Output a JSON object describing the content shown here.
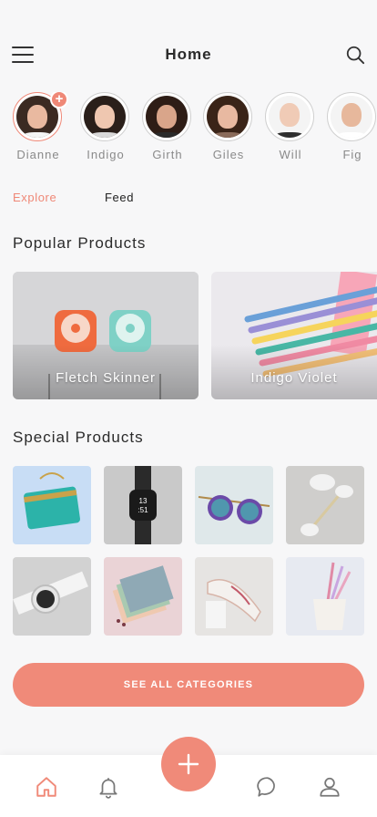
{
  "header": {
    "title": "Home"
  },
  "stories": [
    {
      "name": "Dianne",
      "active": true,
      "skin": "#e9b9a0",
      "hair": "#3b2a22",
      "body": "#ffffff"
    },
    {
      "name": "Indigo",
      "active": false,
      "skin": "#efc7b0",
      "hair": "#2a1f1a",
      "body": "#d9d9d9"
    },
    {
      "name": "Girth",
      "active": false,
      "skin": "#d9a58a",
      "hair": "#2e1d16",
      "body": "#2a2a2a"
    },
    {
      "name": "Giles",
      "active": false,
      "skin": "#e8b9a1",
      "hair": "#3a2418",
      "body": "#8a6b5a"
    },
    {
      "name": "Will",
      "active": false,
      "skin": "#f0cbb6",
      "hair": "#4a3324",
      "body": "#2e2e2e"
    },
    {
      "name": "Fig",
      "active": false,
      "skin": "#e7b89c",
      "hair": "#7a5a3e",
      "body": "#ffffff"
    }
  ],
  "tabs": {
    "explore": "Explore",
    "feed": "Feed"
  },
  "sections": {
    "popular": "Popular Products",
    "special": "Special Products"
  },
  "popular_products": [
    {
      "label": "Fletch Skinner"
    },
    {
      "label": "Indigo Violet"
    }
  ],
  "special_products": [
    {
      "name": "clutch-bag"
    },
    {
      "name": "smart-watch"
    },
    {
      "name": "sunglasses"
    },
    {
      "name": "face-roller"
    },
    {
      "name": "white-watch"
    },
    {
      "name": "notebooks"
    },
    {
      "name": "sneaker"
    },
    {
      "name": "pencil-cup"
    }
  ],
  "cta": {
    "label": "SEE ALL CATEGORIES"
  },
  "colors": {
    "accent": "#f08a79",
    "active_ring": "#ef8877",
    "text": "#2b2b2b",
    "muted": "#8a8a8a"
  },
  "nav": [
    "home-icon",
    "bell-icon",
    "add-icon",
    "chat-icon",
    "user-icon"
  ]
}
